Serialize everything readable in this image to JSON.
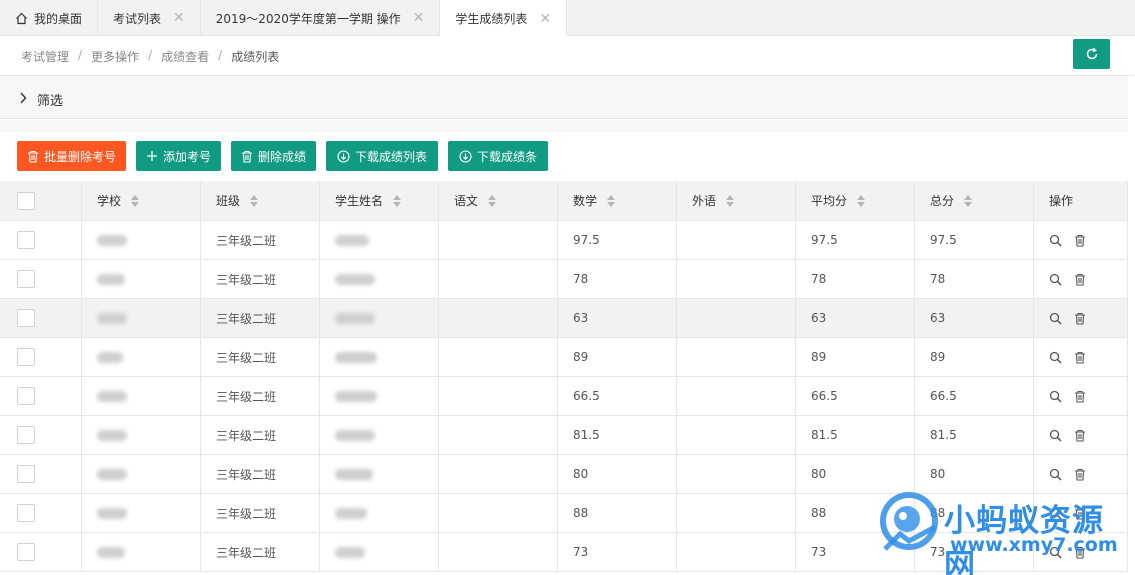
{
  "tabs": [
    {
      "label": "我的桌面",
      "home": true,
      "closable": false
    },
    {
      "label": "考试列表",
      "closable": true
    },
    {
      "label": "2019～2020学年度第一学期 操作",
      "closable": true
    },
    {
      "label": "学生成绩列表",
      "closable": true,
      "active": true
    }
  ],
  "breadcrumb": [
    "考试管理",
    "更多操作",
    "成绩查看",
    "成绩列表"
  ],
  "breadcrumb_sep": "/",
  "filter": {
    "label": "筛选"
  },
  "toolbar": {
    "batch_delete": "批量删除考号",
    "add_exam_no": "添加考号",
    "delete_scores": "删除成绩",
    "download_list": "下载成绩列表",
    "download_slips": "下载成绩条"
  },
  "table": {
    "columns": [
      "学校",
      "班级",
      "学生姓名",
      "语文",
      "数学",
      "外语",
      "平均分",
      "总分",
      "操作"
    ],
    "rows": [
      {
        "class": "三年级二班",
        "chinese": "",
        "math": "97.5",
        "foreign": "",
        "avg": "97.5",
        "total": "97.5"
      },
      {
        "class": "三年级二班",
        "chinese": "",
        "math": "78",
        "foreign": "",
        "avg": "78",
        "total": "78"
      },
      {
        "class": "三年级二班",
        "chinese": "",
        "math": "63",
        "foreign": "",
        "avg": "63",
        "total": "63"
      },
      {
        "class": "三年级二班",
        "chinese": "",
        "math": "89",
        "foreign": "",
        "avg": "89",
        "total": "89"
      },
      {
        "class": "三年级二班",
        "chinese": "",
        "math": "66.5",
        "foreign": "",
        "avg": "66.5",
        "total": "66.5"
      },
      {
        "class": "三年级二班",
        "chinese": "",
        "math": "81.5",
        "foreign": "",
        "avg": "81.5",
        "total": "81.5"
      },
      {
        "class": "三年级二班",
        "chinese": "",
        "math": "80",
        "foreign": "",
        "avg": "80",
        "total": "80"
      },
      {
        "class": "三年级二班",
        "chinese": "",
        "math": "88",
        "foreign": "",
        "avg": "88",
        "total": "88"
      },
      {
        "class": "三年级二班",
        "chinese": "",
        "math": "73",
        "foreign": "",
        "avg": "73",
        "total": "73"
      }
    ]
  },
  "watermark": {
    "title": "小蚂蚁资源网",
    "url": "www.xmy7.com"
  },
  "colors": {
    "accent": "#119b82",
    "danger": "#ff5722",
    "watermark": "#2f8ee8"
  }
}
